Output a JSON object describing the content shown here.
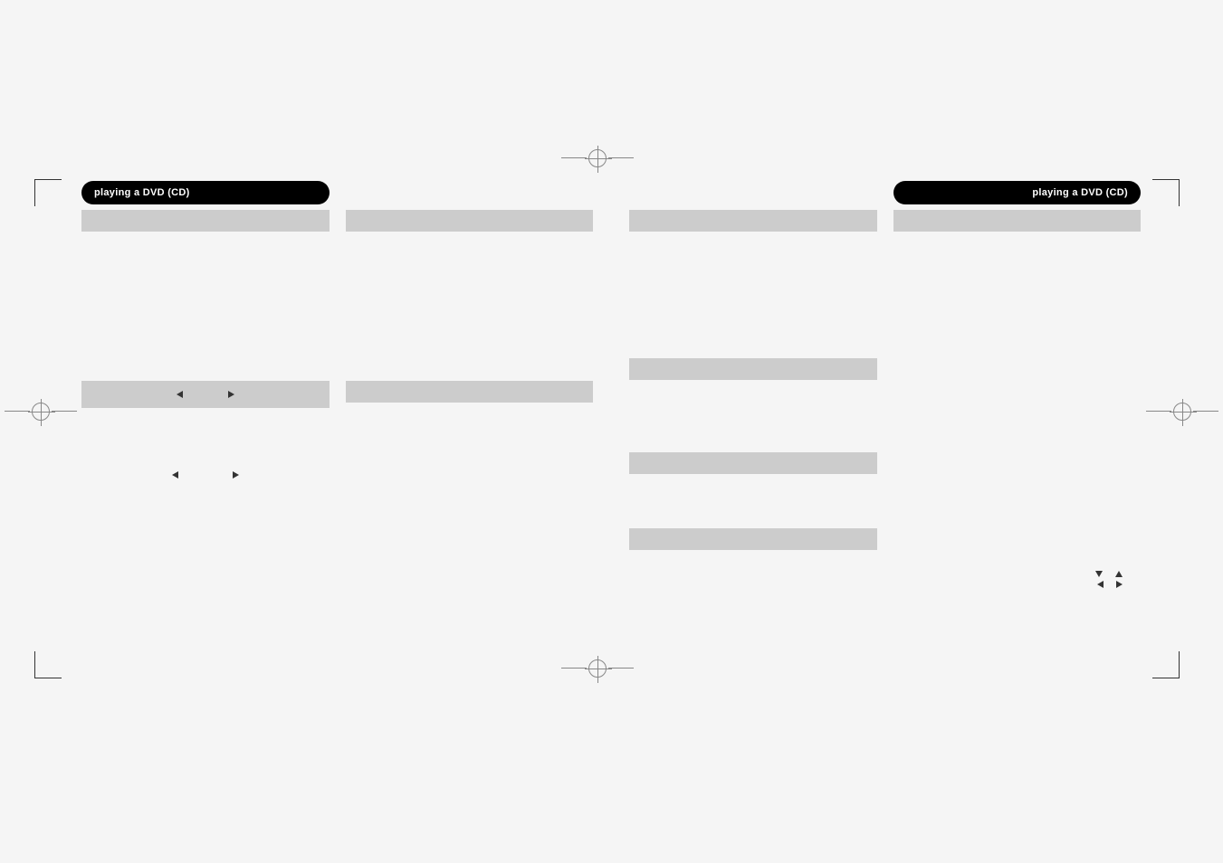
{
  "header": {
    "left_pill": "playing a DVD (CD)",
    "right_pill": "playing a DVD (CD)"
  },
  "left_page": {
    "col1": {
      "section1": "",
      "section2_icons": "◀        ▶"
    },
    "col2": {
      "section1": "",
      "section2": ""
    }
  },
  "right_page": {
    "col1": {
      "section1": "",
      "section2": "",
      "section3": "",
      "section4": ""
    },
    "col2": {
      "section1": "",
      "arrows_row1": "▼  ▲",
      "arrows_row2": "◀  ▶"
    }
  },
  "page_numbers": {
    "left": "",
    "right": ""
  }
}
